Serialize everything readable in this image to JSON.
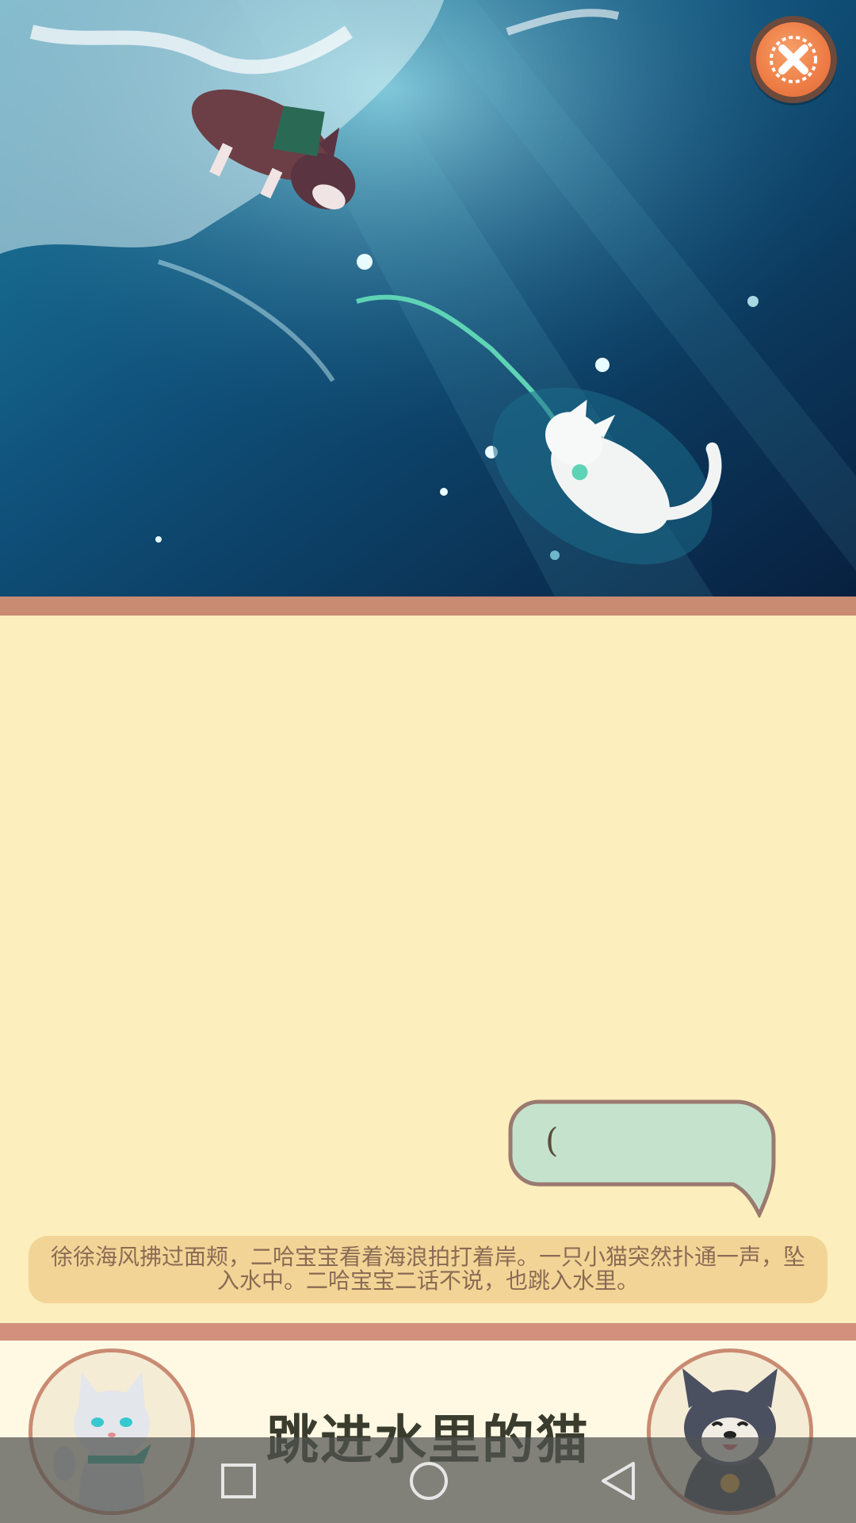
{
  "scene": {
    "description_icon": "underwater-illustration"
  },
  "close_button": {
    "icon": "close-icon"
  },
  "speech_bubble": {
    "text": "("
  },
  "narration": {
    "text": "徐徐海风拂过面颊，二哈宝宝看着海浪拍打着岸。一只小猫突然扑通一声，坠入水中。二哈宝宝二话不说，也跳入水里。"
  },
  "footer": {
    "title": "跳进水里的猫"
  },
  "navbar": {
    "recents_icon": "square-icon",
    "home_icon": "circle-icon",
    "back_icon": "triangle-back-icon"
  },
  "colors": {
    "page_bg": "#fdeebd",
    "band": "#c98b72",
    "bubble_fill": "#c5e3cc",
    "narration_bg": "#f2d596",
    "close_orange": "#ee7c45"
  }
}
